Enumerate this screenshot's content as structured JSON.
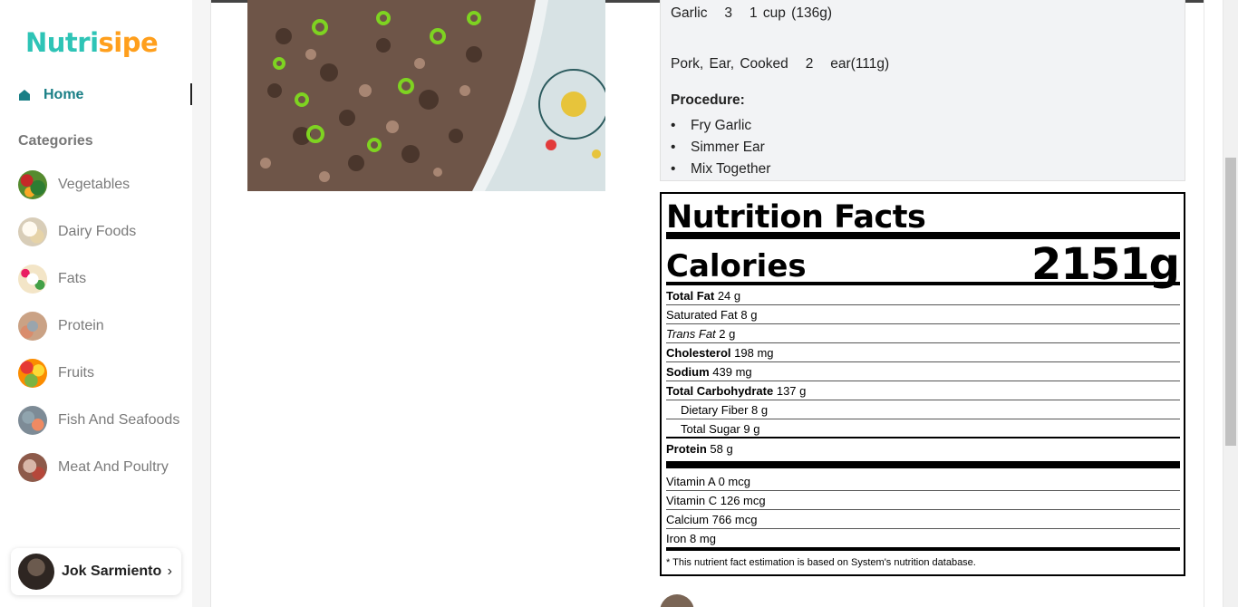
{
  "brand": {
    "part1": "Nutri",
    "part2": "sipe"
  },
  "nav": {
    "home": "Home"
  },
  "categories": {
    "title": "Categories",
    "items": [
      {
        "label": "Vegetables",
        "icon": "vegetables-icon"
      },
      {
        "label": "Dairy Foods",
        "icon": "dairy-icon"
      },
      {
        "label": "Fats",
        "icon": "fats-icon"
      },
      {
        "label": "Protein",
        "icon": "protein-icon"
      },
      {
        "label": "Fruits",
        "icon": "fruits-icon"
      },
      {
        "label": "Fish And Seafoods",
        "icon": "fish-icon"
      },
      {
        "label": "Meat And Poultry",
        "icon": "meat-icon"
      }
    ]
  },
  "user": {
    "name": "Jok Sarmiento",
    "chevron": "›"
  },
  "recipe": {
    "ingredients": [
      {
        "name": "Garlic",
        "qty": "3",
        "unit": "1 cup (136g)"
      },
      {
        "name": "Pork, Ear, Cooked",
        "qty": "2",
        "unit": "ear(111g)"
      }
    ],
    "procedure_title": "Procedure:",
    "procedure": [
      "Fry Garlic",
      "Simmer Ear",
      "Mix Together"
    ]
  },
  "nutrition": {
    "title": "Nutrition Facts",
    "calories_label": "Calories",
    "calories_value": "2151g",
    "rows": [
      {
        "label": "Total Fat",
        "value": "24 g",
        "style": "bold"
      },
      {
        "label": "Saturated Fat",
        "value": "8 g",
        "style": "normal"
      },
      {
        "label": "Trans Fat",
        "value": "2 g",
        "style": "italic"
      },
      {
        "label": "Cholesterol",
        "value": "198 mg",
        "style": "bold"
      },
      {
        "label": "Sodium",
        "value": "439 mg",
        "style": "bold"
      },
      {
        "label": "Total Carbohydrate",
        "value": "137 g",
        "style": "bold"
      },
      {
        "label": "Dietary Fiber",
        "value": "8 g",
        "style": "indent"
      },
      {
        "label": "Total Sugar",
        "value": "9 g",
        "style": "indent"
      },
      {
        "label": "Protein",
        "value": "58 g",
        "style": "bold"
      }
    ],
    "vitamins": [
      {
        "label": "Vitamin A",
        "value": "0 mcg"
      },
      {
        "label": "Vitamin C",
        "value": "126 mcg"
      },
      {
        "label": "Calcium",
        "value": "766 mcg"
      },
      {
        "label": "Iron",
        "value": "8 mg"
      }
    ],
    "note": "* This nutrient fact estimation is based on System's nutrition database."
  },
  "colors": {
    "accent": "#1a7f86",
    "brand_teal": "#2ec4b6",
    "brand_orange": "#ff9f1c"
  }
}
